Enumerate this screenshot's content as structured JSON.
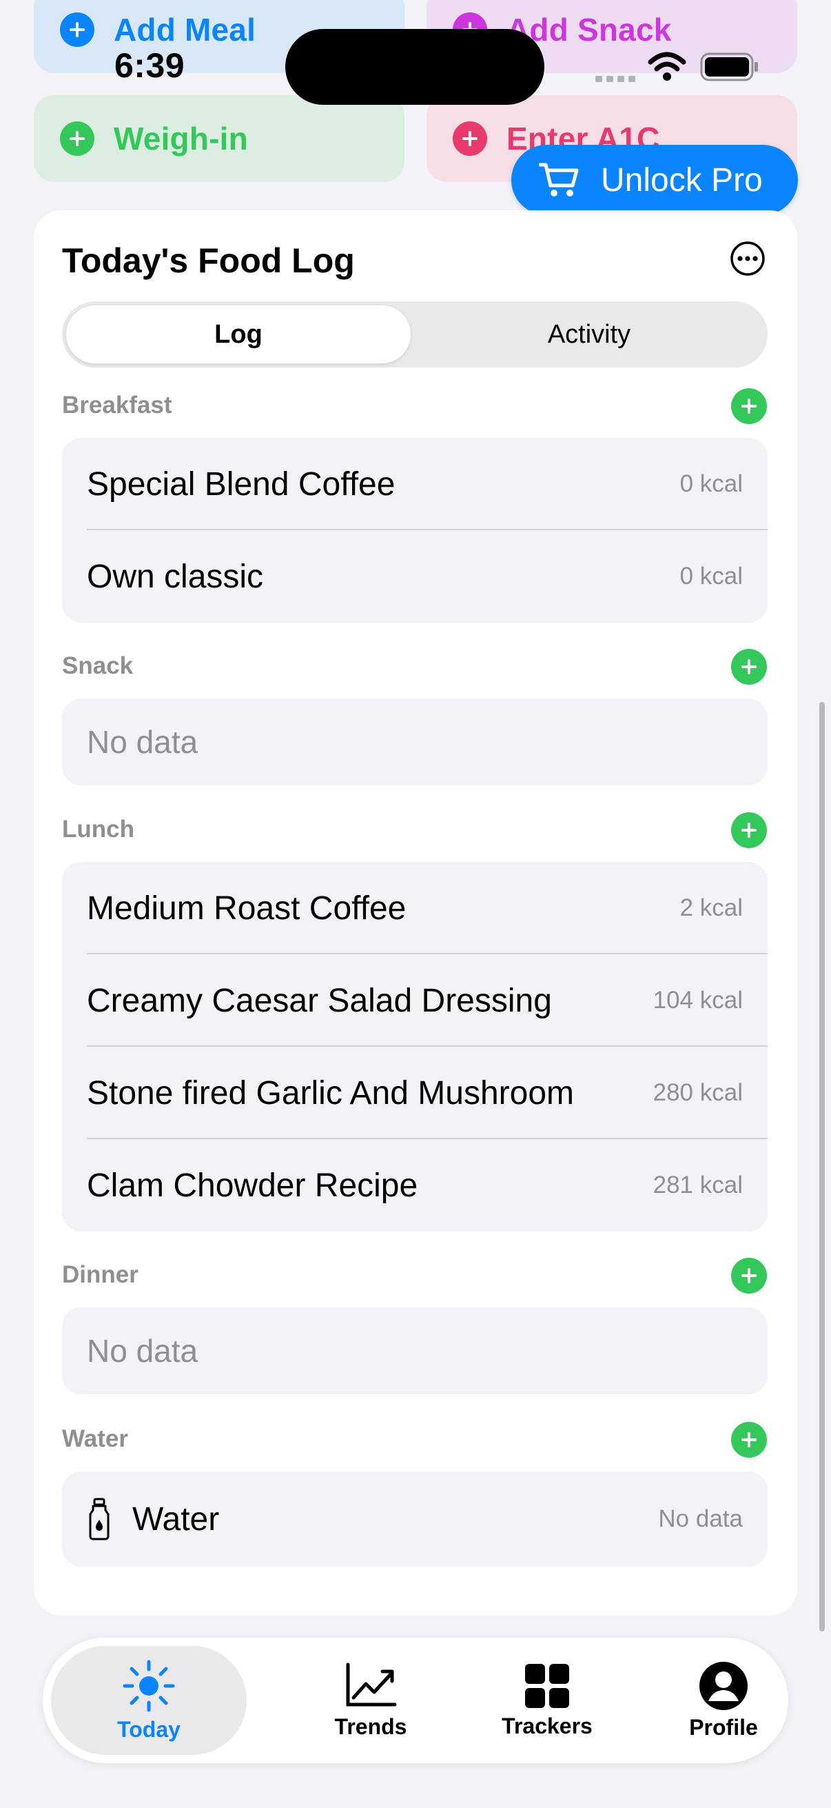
{
  "status_bar": {
    "time": "6:39"
  },
  "quick_actions": [
    {
      "label": "Add Meal",
      "bg": "#D8E8F7",
      "fg": "#0A84FF"
    },
    {
      "label": "Add Snack",
      "bg": "#EEDCF3",
      "fg": "#CF35DF"
    },
    {
      "label": "Weigh-in",
      "bg": "#DCEEE2",
      "fg": "#34C759"
    },
    {
      "label": "Enter A1C",
      "bg": "#F5DEE6",
      "fg": "#E93A6E"
    }
  ],
  "unlock_button": {
    "label": "Unlock Pro",
    "icon": "cart-icon"
  },
  "food_log": {
    "title": "Today's Food Log",
    "more_icon": "ellipsis-circle-icon",
    "segments": {
      "selected": "Log",
      "other": "Activity"
    },
    "sections": {
      "breakfast": {
        "title": "Breakfast",
        "items": [
          {
            "name": "Special Blend Coffee",
            "kcal": "0 kcal"
          },
          {
            "name": "Own classic",
            "kcal": "0 kcal"
          }
        ]
      },
      "snack": {
        "title": "Snack",
        "empty": "No data"
      },
      "lunch": {
        "title": "Lunch",
        "items": [
          {
            "name": "Medium Roast Coffee",
            "kcal": "2 kcal"
          },
          {
            "name": "Creamy Caesar Salad Dressing",
            "kcal": "104 kcal"
          },
          {
            "name": "Stone fired Garlic And Mushroom",
            "kcal": "280 kcal"
          },
          {
            "name": "Clam Chowder Recipe",
            "kcal": "281 kcal"
          }
        ]
      },
      "dinner": {
        "title": "Dinner",
        "empty": "No data"
      },
      "water": {
        "title": "Water",
        "item": {
          "name": "Water",
          "value": "No data",
          "icon": "water-bottle-icon"
        }
      }
    }
  },
  "tab_bar": {
    "active_color": "#0A84FF",
    "tabs": [
      {
        "label": "Today",
        "icon": "sun-icon"
      },
      {
        "label": "Trends",
        "icon": "chart-trend-icon"
      },
      {
        "label": "Trackers",
        "icon": "grid-icon"
      },
      {
        "label": "Profile",
        "icon": "person-circle-icon"
      }
    ]
  }
}
